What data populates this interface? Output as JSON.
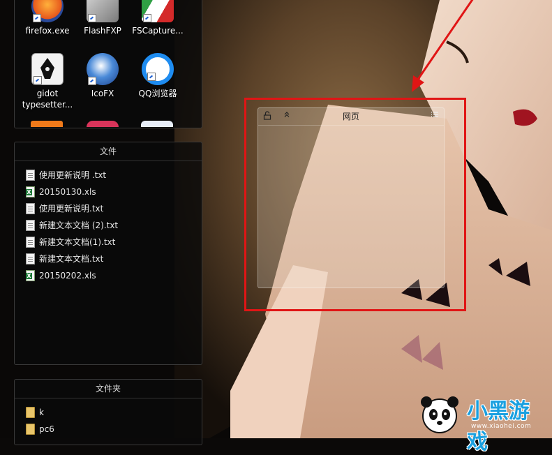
{
  "desktop_icons": [
    {
      "label": "firefox.exe",
      "icon": "firefox-icon"
    },
    {
      "label": "FlashFXP",
      "icon": "flashfxp-icon"
    },
    {
      "label": "FSCapture...",
      "icon": "fscapture-icon"
    },
    {
      "label": "gidot typesetter...",
      "icon": "pen-nib-icon"
    },
    {
      "label": "IcoFX",
      "icon": "icofx-icon"
    },
    {
      "label": "QQ浏览器",
      "icon": "qq-browser-icon"
    }
  ],
  "files_panel": {
    "title": "文件",
    "items": [
      {
        "name": "使用更新说明 .txt",
        "type": "txt"
      },
      {
        "name": "20150130.xls",
        "type": "xls"
      },
      {
        "name": "使用更新说明.txt",
        "type": "txt"
      },
      {
        "name": "新建文本文档 (2).txt",
        "type": "txt"
      },
      {
        "name": "新建文本文档(1).txt",
        "type": "txt"
      },
      {
        "name": "新建文本文档.txt",
        "type": "txt"
      },
      {
        "name": "20150202.xls",
        "type": "xls"
      }
    ]
  },
  "folders_panel": {
    "title": "文件夹",
    "items": [
      {
        "name": "k"
      },
      {
        "name": "pc6"
      }
    ]
  },
  "web_widget": {
    "title": "网页",
    "icons": [
      "unlock-icon",
      "collapse-icon",
      "list-icon"
    ]
  },
  "watermark": {
    "text": "小黑游戏",
    "url": "www.xiaohei.com"
  },
  "colors": {
    "highlight": "#e01515",
    "arrow": "#e01515"
  }
}
